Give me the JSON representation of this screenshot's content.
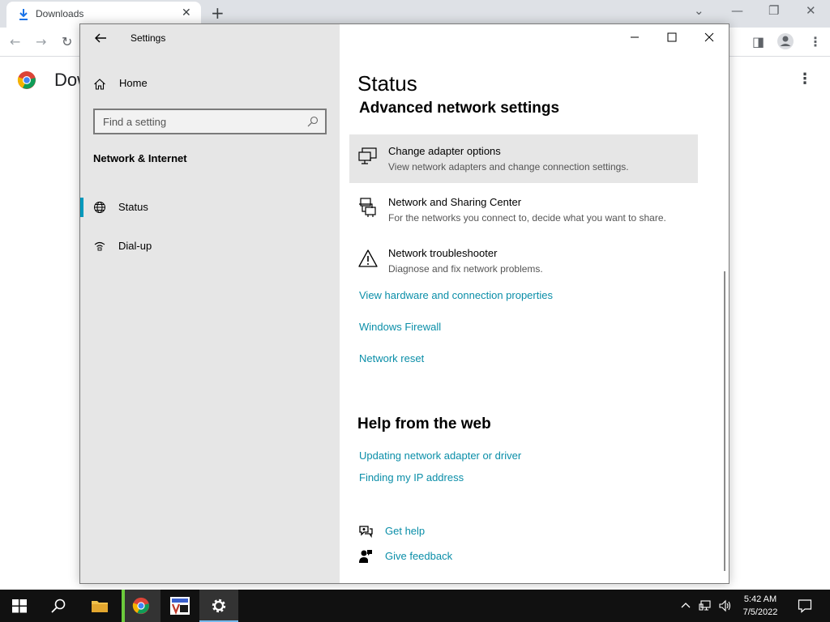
{
  "browser": {
    "tab_title": "Downloads",
    "page_title": "Dow"
  },
  "settings": {
    "window_title": "Settings",
    "home_label": "Home",
    "search_placeholder": "Find a setting",
    "section_heading": "Network & Internet",
    "nav_items": [
      {
        "label": "Status",
        "icon": "globe-icon",
        "selected": true
      },
      {
        "label": "Dial-up",
        "icon": "dialup-icon",
        "selected": false
      }
    ],
    "content": {
      "title": "Status",
      "subtitle": "Advanced network settings",
      "options": [
        {
          "title": "Change adapter options",
          "desc": "View network adapters and change connection settings.",
          "icon": "adapter-icon"
        },
        {
          "title": "Network and Sharing Center",
          "desc": "For the networks you connect to, decide what you want to share.",
          "icon": "sharing-center-icon"
        },
        {
          "title": "Network troubleshooter",
          "desc": "Diagnose and fix network problems.",
          "icon": "warning-icon"
        }
      ],
      "links": [
        "View hardware and connection properties",
        "Windows Firewall",
        "Network reset"
      ],
      "help_heading": "Help from the web",
      "help_links": [
        "Updating network adapter or driver",
        "Finding my IP address"
      ],
      "get_help": "Get help",
      "give_feedback": "Give feedback"
    }
  },
  "taskbar": {
    "time": "5:42 AM",
    "date": "7/5/2022"
  },
  "colors": {
    "accent": "#0099bc",
    "link": "#0a8ea8",
    "nav_bg": "#e6e6e6",
    "taskbar_bg": "#111111"
  }
}
